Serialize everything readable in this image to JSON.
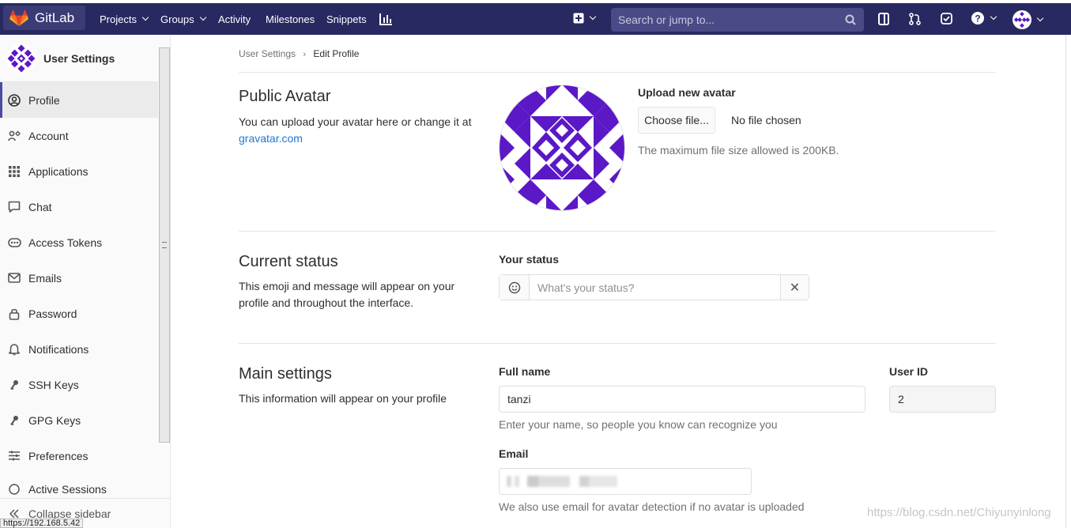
{
  "colors": {
    "nav_bg": "#292961",
    "accent": "#4b4ba3",
    "avatar": "#5b18c6",
    "link": "#1f78d1"
  },
  "navbar": {
    "brand": "GitLab",
    "items": [
      {
        "label": "Projects",
        "dropdown": true
      },
      {
        "label": "Groups",
        "dropdown": true
      },
      {
        "label": "Activity"
      },
      {
        "label": "Milestones"
      },
      {
        "label": "Snippets"
      }
    ],
    "search_placeholder": "Search or jump to...",
    "icons": [
      "chart-icon",
      "plus-icon",
      "search-icon",
      "sidebar-toggle-icon",
      "merge-request-icon",
      "todo-icon",
      "help-icon",
      "avatar"
    ]
  },
  "sidebar": {
    "title": "User Settings",
    "items": [
      {
        "label": "Profile",
        "icon": "profile-icon",
        "active": true
      },
      {
        "label": "Account",
        "icon": "account-icon"
      },
      {
        "label": "Applications",
        "icon": "applications-icon"
      },
      {
        "label": "Chat",
        "icon": "chat-icon"
      },
      {
        "label": "Access Tokens",
        "icon": "token-icon"
      },
      {
        "label": "Emails",
        "icon": "email-icon"
      },
      {
        "label": "Password",
        "icon": "lock-icon"
      },
      {
        "label": "Notifications",
        "icon": "bell-icon"
      },
      {
        "label": "SSH Keys",
        "icon": "key-icon"
      },
      {
        "label": "GPG Keys",
        "icon": "key-icon"
      },
      {
        "label": "Preferences",
        "icon": "sliders-icon"
      },
      {
        "label": "Active Sessions",
        "icon": "sessions-icon"
      }
    ],
    "collapse_label": "Collapse sidebar"
  },
  "statusbar_url": "https://192.168.5.42",
  "breadcrumb": {
    "parent": "User Settings",
    "current": "Edit Profile"
  },
  "avatar_section": {
    "title": "Public Avatar",
    "desc": "You can upload your avatar here or change it at",
    "link": "gravatar.com",
    "upload_label": "Upload new avatar",
    "choose_button": "Choose file...",
    "no_file": "No file chosen",
    "max_size": "The maximum file size allowed is 200KB."
  },
  "status_section": {
    "title": "Current status",
    "desc": "This emoji and message will appear on your profile and throughout the interface.",
    "label": "Your status",
    "placeholder": "What's your status?",
    "clear": "✕"
  },
  "main_section": {
    "title": "Main settings",
    "desc": "This information will appear on your profile",
    "full_name_label": "Full name",
    "full_name_value": "tanzi",
    "full_name_help": "Enter your name, so people you know can recognize you",
    "user_id_label": "User ID",
    "user_id_value": "2",
    "email_label": "Email",
    "email_help": "We also use email for avatar detection if no avatar is uploaded"
  },
  "watermark": "https://blog.csdn.net/Chiyunyinlong"
}
